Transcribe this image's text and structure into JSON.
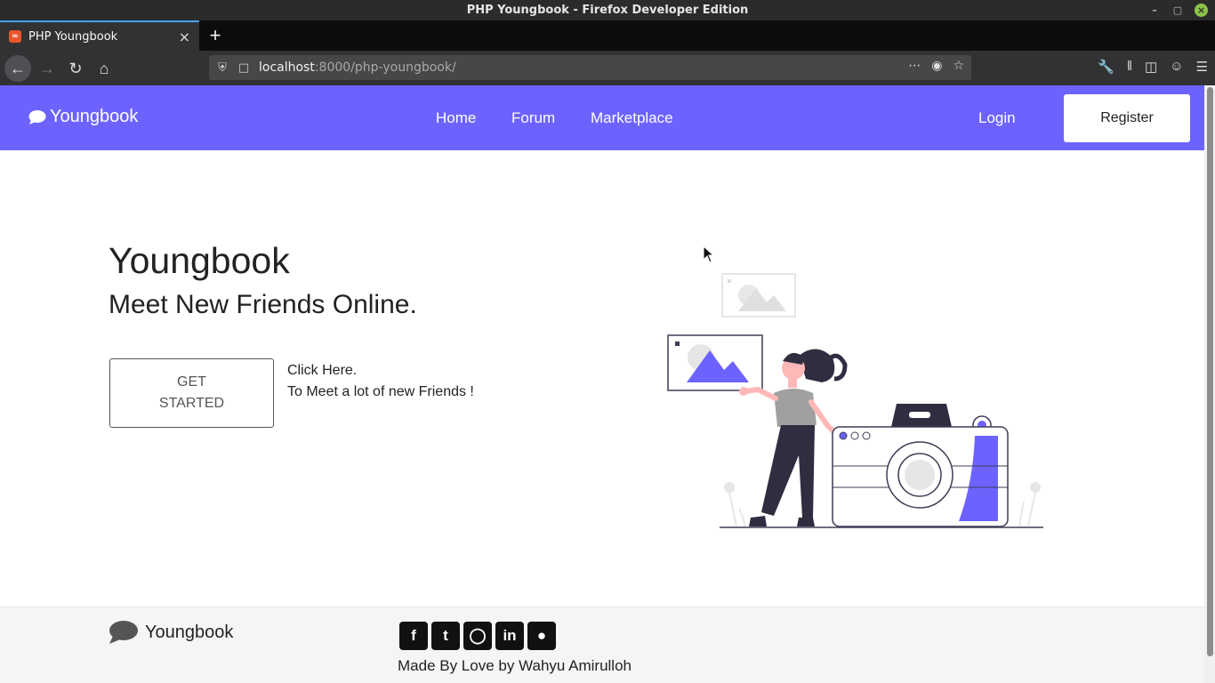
{
  "window": {
    "title": "PHP Youngbook - Firefox Developer Edition"
  },
  "tab": {
    "title": "PHP Youngbook"
  },
  "url": {
    "host": "localhost",
    "rest": ":8000/php-youngbook/"
  },
  "site": {
    "brand": "Youngbook",
    "nav": [
      "Home",
      "Forum",
      "Marketplace"
    ],
    "login": "Login",
    "register": "Register"
  },
  "hero": {
    "title": "Youngbook",
    "subtitle": "Meet New Friends Online.",
    "cta": "GET STARTED",
    "note_line1": "Click Here.",
    "note_line2": "To Meet a lot of new Friends !"
  },
  "footer": {
    "brand": "Youngbook",
    "socials": [
      "facebook-icon",
      "twitter-icon",
      "instagram-icon",
      "linkedin-icon",
      "github-icon"
    ],
    "credit": "Made By Love by Wahyu Amirulloh"
  },
  "colors": {
    "accent": "#6c63ff"
  }
}
